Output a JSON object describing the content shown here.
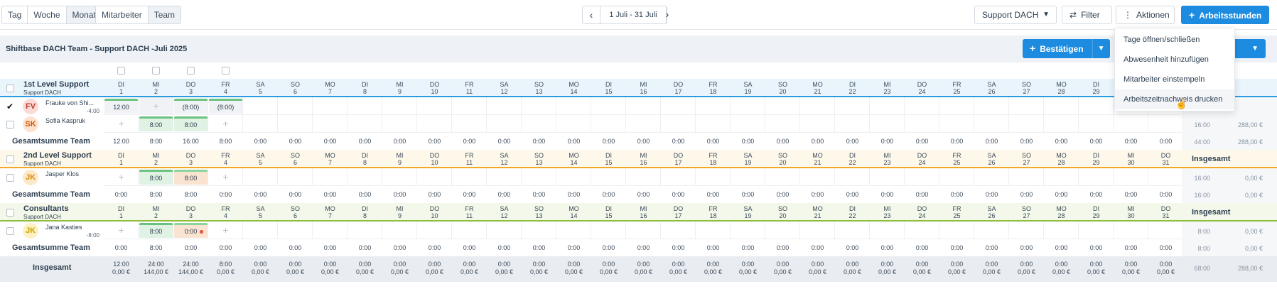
{
  "toolbar": {
    "view_tabs": [
      "Tag",
      "Woche",
      "Monat"
    ],
    "group_tabs": [
      "Mitarbeiter",
      "Team"
    ],
    "date_range": "1 Juli - 31 Juli",
    "prev_icon": "chevron-left-icon",
    "next_icon": "chevron-right-icon",
    "location_select": "Support DACH",
    "filter_label": "Filter",
    "actions_label": "Aktionen",
    "add_hours_label": "Arbeitsstunden",
    "accent_color": "#1d8ce0"
  },
  "title": "Shiftbase DACH Team - Support DACH -Juli 2025",
  "confirm_label": "Bestätigen",
  "menu": {
    "items": [
      "Tage öffnen/schließen",
      "Abwesenheit hinzufügen",
      "Mitarbeiter einstempeln",
      "Arbeitszeitnachweis drucken"
    ]
  },
  "days": [
    {
      "d": "DI",
      "n": "1"
    },
    {
      "d": "MI",
      "n": "2"
    },
    {
      "d": "DO",
      "n": "3"
    },
    {
      "d": "FR",
      "n": "4"
    },
    {
      "d": "SA",
      "n": "5"
    },
    {
      "d": "SO",
      "n": "6"
    },
    {
      "d": "MO",
      "n": "7"
    },
    {
      "d": "DI",
      "n": "8"
    },
    {
      "d": "MI",
      "n": "9"
    },
    {
      "d": "DO",
      "n": "10"
    },
    {
      "d": "FR",
      "n": "11"
    },
    {
      "d": "SA",
      "n": "12"
    },
    {
      "d": "SO",
      "n": "13"
    },
    {
      "d": "MO",
      "n": "14"
    },
    {
      "d": "DI",
      "n": "15"
    },
    {
      "d": "MI",
      "n": "16"
    },
    {
      "d": "DO",
      "n": "17"
    },
    {
      "d": "FR",
      "n": "18"
    },
    {
      "d": "SA",
      "n": "19"
    },
    {
      "d": "SO",
      "n": "20"
    },
    {
      "d": "MO",
      "n": "21"
    },
    {
      "d": "DI",
      "n": "22"
    },
    {
      "d": "MI",
      "n": "23"
    },
    {
      "d": "DO",
      "n": "24"
    },
    {
      "d": "FR",
      "n": "25"
    },
    {
      "d": "SA",
      "n": "26"
    },
    {
      "d": "SO",
      "n": "27"
    },
    {
      "d": "MO",
      "n": "28"
    },
    {
      "d": "DI",
      "n": "29"
    },
    {
      "d": "MI",
      "n": "30"
    },
    {
      "d": "DO",
      "n": "31"
    }
  ],
  "insgesamt_label": "Insgesamt",
  "sum_label": "Gesamtsumme Team",
  "groups": [
    {
      "name": "1st Level Support",
      "sub": "Support DACH",
      "color": "#2b9be0",
      "band": "#eaf4fb",
      "visible_days": 29,
      "show_insgesamt": false,
      "employees": [
        {
          "initials": "FV",
          "name": "Frauke von Shi...",
          "balance": "-4:00",
          "avatar_bg": "#fadbd8",
          "avatar_fg": "#c0392b",
          "checked": true,
          "hours": "",
          "money": "",
          "cells": [
            {
              "type": "grey",
              "text": "12:00"
            },
            {
              "type": "plus",
              "text": ""
            },
            {
              "type": "grey",
              "text": "(8:00)"
            },
            {
              "type": "grey",
              "text": "(8:00)"
            }
          ]
        },
        {
          "initials": "SK",
          "name": "Sofia Kaspruk",
          "balance": "",
          "avatar_bg": "#fde3cf",
          "avatar_fg": "#d35400",
          "checked": false,
          "hours": "16:00",
          "money": "288,00 €",
          "cells": [
            {
              "type": "plus",
              "text": ""
            },
            {
              "type": "green",
              "text": "8:00"
            },
            {
              "type": "green",
              "text": "8:00"
            },
            {
              "type": "plus",
              "text": ""
            }
          ]
        }
      ],
      "sums": [
        "12:00",
        "8:00",
        "16:00",
        "8:00",
        "0:00",
        "0:00",
        "0:00",
        "0:00",
        "0:00",
        "0:00",
        "0:00",
        "0:00",
        "0:00",
        "0:00",
        "0:00",
        "0:00",
        "0:00",
        "0:00",
        "0:00",
        "0:00",
        "0:00",
        "0:00",
        "0:00",
        "0:00",
        "0:00",
        "0:00",
        "0:00",
        "0:00",
        "0:00",
        "0:00",
        "0:00"
      ],
      "sum_hours": "44:00",
      "sum_money": "288,00 €"
    },
    {
      "name": "2nd Level Support",
      "sub": "Support DACH",
      "color": "#f5a623",
      "band": "#fdf8ea",
      "visible_days": 31,
      "show_insgesamt": true,
      "employees": [
        {
          "initials": "JK",
          "name": "Jasper Klos",
          "balance": "",
          "avatar_bg": "#fde9c9",
          "avatar_fg": "#d68910",
          "checked": false,
          "hours": "16:00",
          "money": "0,00 €",
          "cells": [
            {
              "type": "plus",
              "text": ""
            },
            {
              "type": "green",
              "text": "8:00"
            },
            {
              "type": "orange",
              "text": "8:00"
            },
            {
              "type": "plus",
              "text": ""
            }
          ]
        }
      ],
      "sums": [
        "0:00",
        "8:00",
        "8:00",
        "0:00",
        "0:00",
        "0:00",
        "0:00",
        "0:00",
        "0:00",
        "0:00",
        "0:00",
        "0:00",
        "0:00",
        "0:00",
        "0:00",
        "0:00",
        "0:00",
        "0:00",
        "0:00",
        "0:00",
        "0:00",
        "0:00",
        "0:00",
        "0:00",
        "0:00",
        "0:00",
        "0:00",
        "0:00",
        "0:00",
        "0:00",
        "0:00"
      ],
      "sum_hours": "16:00",
      "sum_money": "0,00 €"
    },
    {
      "name": "Consultants",
      "sub": "Support DACH",
      "color": "#8fbe3a",
      "band": "#f3f8ea",
      "visible_days": 31,
      "show_insgesamt": true,
      "employees": [
        {
          "initials": "JK",
          "name": "Jana Kasties",
          "balance": "-8:00",
          "avatar_bg": "#fdf1c4",
          "avatar_fg": "#c9a300",
          "checked": false,
          "hours": "8:00",
          "money": "0,00 €",
          "cells": [
            {
              "type": "plus",
              "text": ""
            },
            {
              "type": "green",
              "text": "8:00"
            },
            {
              "type": "orange-dot",
              "text": "0:00"
            },
            {
              "type": "plus",
              "text": ""
            }
          ]
        }
      ],
      "sums": [
        "0:00",
        "8:00",
        "0:00",
        "0:00",
        "0:00",
        "0:00",
        "0:00",
        "0:00",
        "0:00",
        "0:00",
        "0:00",
        "0:00",
        "0:00",
        "0:00",
        "0:00",
        "0:00",
        "0:00",
        "0:00",
        "0:00",
        "0:00",
        "0:00",
        "0:00",
        "0:00",
        "0:00",
        "0:00",
        "0:00",
        "0:00",
        "0:00",
        "0:00",
        "0:00",
        "0:00"
      ],
      "sum_hours": "8:00",
      "sum_money": "0,00 €"
    }
  ],
  "totals": {
    "label": "Insgesamt",
    "hours": [
      "12:00",
      "24:00",
      "24:00",
      "8:00",
      "0:00",
      "0:00",
      "0:00",
      "0:00",
      "0:00",
      "0:00",
      "0:00",
      "0:00",
      "0:00",
      "0:00",
      "0:00",
      "0:00",
      "0:00",
      "0:00",
      "0:00",
      "0:00",
      "0:00",
      "0:00",
      "0:00",
      "0:00",
      "0:00",
      "0:00",
      "0:00",
      "0:00",
      "0:00",
      "0:00",
      "0:00"
    ],
    "money": [
      "0,00 €",
      "144,00 €",
      "144,00 €",
      "0,00 €",
      "0,00 €",
      "0,00 €",
      "0,00 €",
      "0,00 €",
      "0,00 €",
      "0,00 €",
      "0,00 €",
      "0,00 €",
      "0,00 €",
      "0,00 €",
      "0,00 €",
      "0,00 €",
      "0,00 €",
      "0,00 €",
      "0,00 €",
      "0,00 €",
      "0,00 €",
      "0,00 €",
      "0,00 €",
      "0,00 €",
      "0,00 €",
      "0,00 €",
      "0,00 €",
      "0,00 €",
      "0,00 €",
      "0,00 €",
      "0,00 €"
    ],
    "sum_hours": "68:00",
    "sum_money": "288,00 €"
  }
}
